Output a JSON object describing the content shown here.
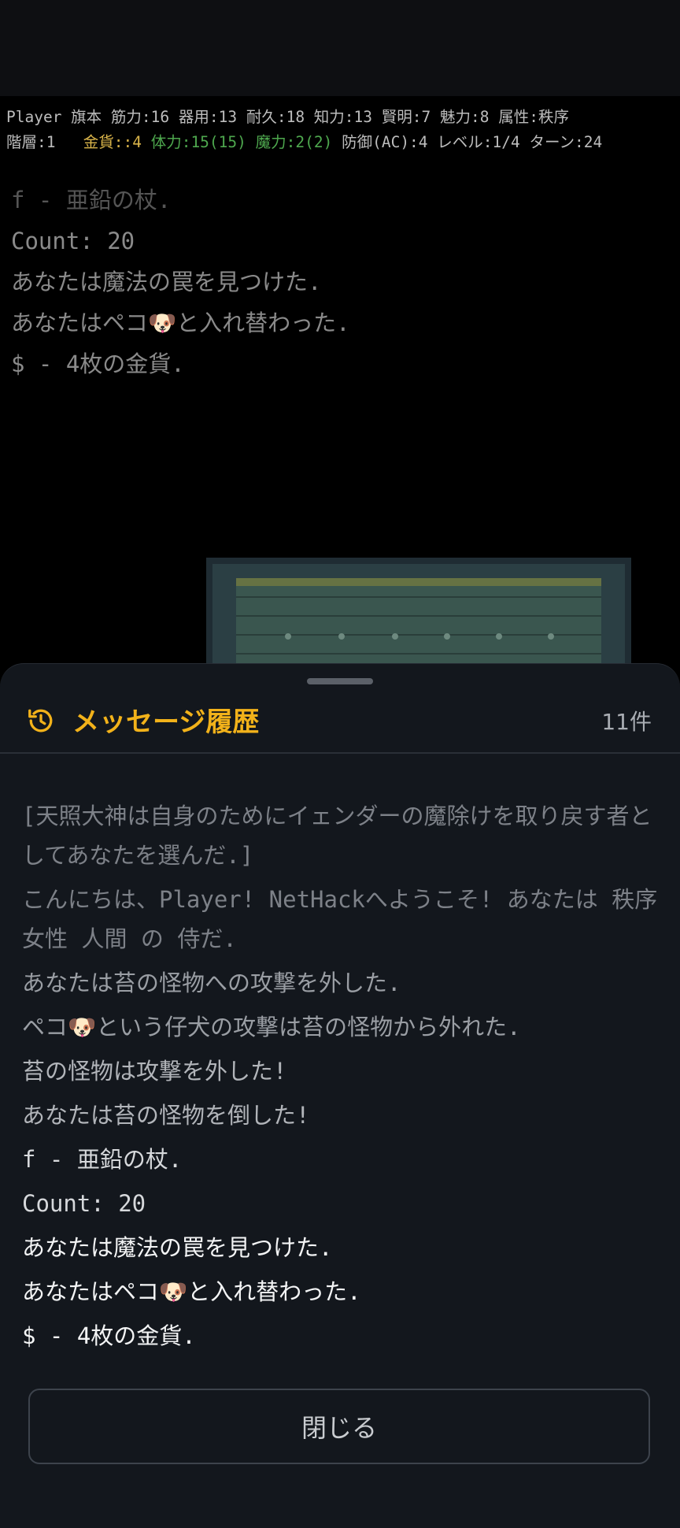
{
  "status": {
    "line1": "Player 旗本 筋力:16 器用:13 耐久:18 知力:13 賢明:7 魅力:8 属性:秩序",
    "depth": "階層:1",
    "gold": "金貨::4",
    "hp": "体力:15(15)",
    "mp": "魔力:2(2)",
    "rest": "防御(AC):4 レベル:1/4 ターン:24"
  },
  "messages": [
    "f - 亜鉛の杖.",
    "Count: 20",
    "あなたは魔法の罠を見つけた.",
    "あなたはペコ🐶と入れ替わった.",
    "$ - 4枚の金貨."
  ],
  "sheet": {
    "icon": "history-icon",
    "title": "メッセージ履歴",
    "count": "11件",
    "history": [
      "[天照大神は自身のためにイェンダーの魔除けを取り戻す者としてあなたを選んだ.]",
      "こんにちは、Player! NetHackへようこそ! あなたは 秩序 女性 人間 の 侍だ.",
      "あなたは苔の怪物への攻撃を外した.",
      "ペコ🐶という仔犬の攻撃は苔の怪物から外れた.",
      "苔の怪物は攻撃を外した!",
      "あなたは苔の怪物を倒した!",
      "f - 亜鉛の杖.",
      "Count: 20",
      "あなたは魔法の罠を見つけた.",
      "あなたはペコ🐶と入れ替わった.",
      "$ - 4枚の金貨."
    ],
    "close_label": "閉じる"
  },
  "colors": {
    "accent": "#f2b21a",
    "gold": "#d8b34a",
    "hp": "#4ea84e",
    "sheet_bg": "#13171d"
  }
}
